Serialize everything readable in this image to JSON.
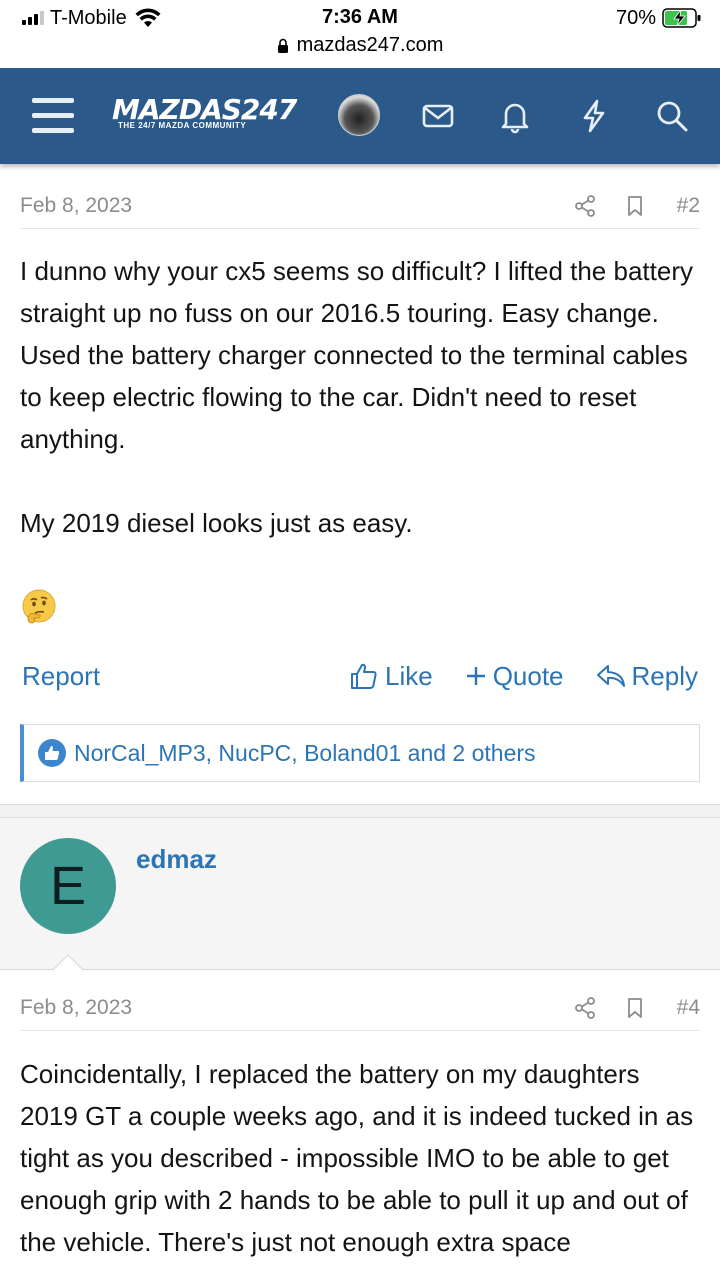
{
  "status_bar": {
    "carrier": "T-Mobile",
    "time": "7:36 AM",
    "battery": "70%",
    "url": "mazdas247.com"
  },
  "header": {
    "logo_text": "MAZDAS247",
    "logo_tagline": "THE 24/7 MAZDA COMMUNITY",
    "brand_color": "#2b5a8a",
    "icons": [
      "menu-icon",
      "user-avatar",
      "envelope-icon",
      "bell-icon",
      "bolt-icon",
      "search-icon"
    ]
  },
  "posts": [
    {
      "date": "Feb 8, 2023",
      "number": "#2",
      "paragraphs": [
        "I dunno why your cx5 seems so difficult? I lifted the battery straight up no fuss on our 2016.5 touring. Easy change. Used the battery charger connected to the terminal cables to keep electric flowing to the car. Didn't need to reset anything.",
        "My 2019 diesel looks just as easy."
      ],
      "emoji": "thinking-face",
      "actions": {
        "report": "Report",
        "like": "Like",
        "quote": "Quote",
        "reply": "Reply"
      },
      "likes_text": "NorCal_MP3, NucPC, Boland01 and 2 others"
    },
    {
      "author": "edmaz",
      "avatar_letter": "E",
      "avatar_color": "#3e9a92",
      "date": "Feb 8, 2023",
      "number": "#4",
      "paragraphs": [
        "Coincidentally, I replaced the battery on my daughters 2019 GT a couple weeks ago, and it is indeed tucked in as tight as you described - impossible IMO to be able to get enough grip with 2 hands to be able to pull it up and out of the vehicle. There's just not enough extra space"
      ]
    }
  ],
  "colors": {
    "link": "#2b75b6",
    "meta": "#8c8c8c"
  }
}
